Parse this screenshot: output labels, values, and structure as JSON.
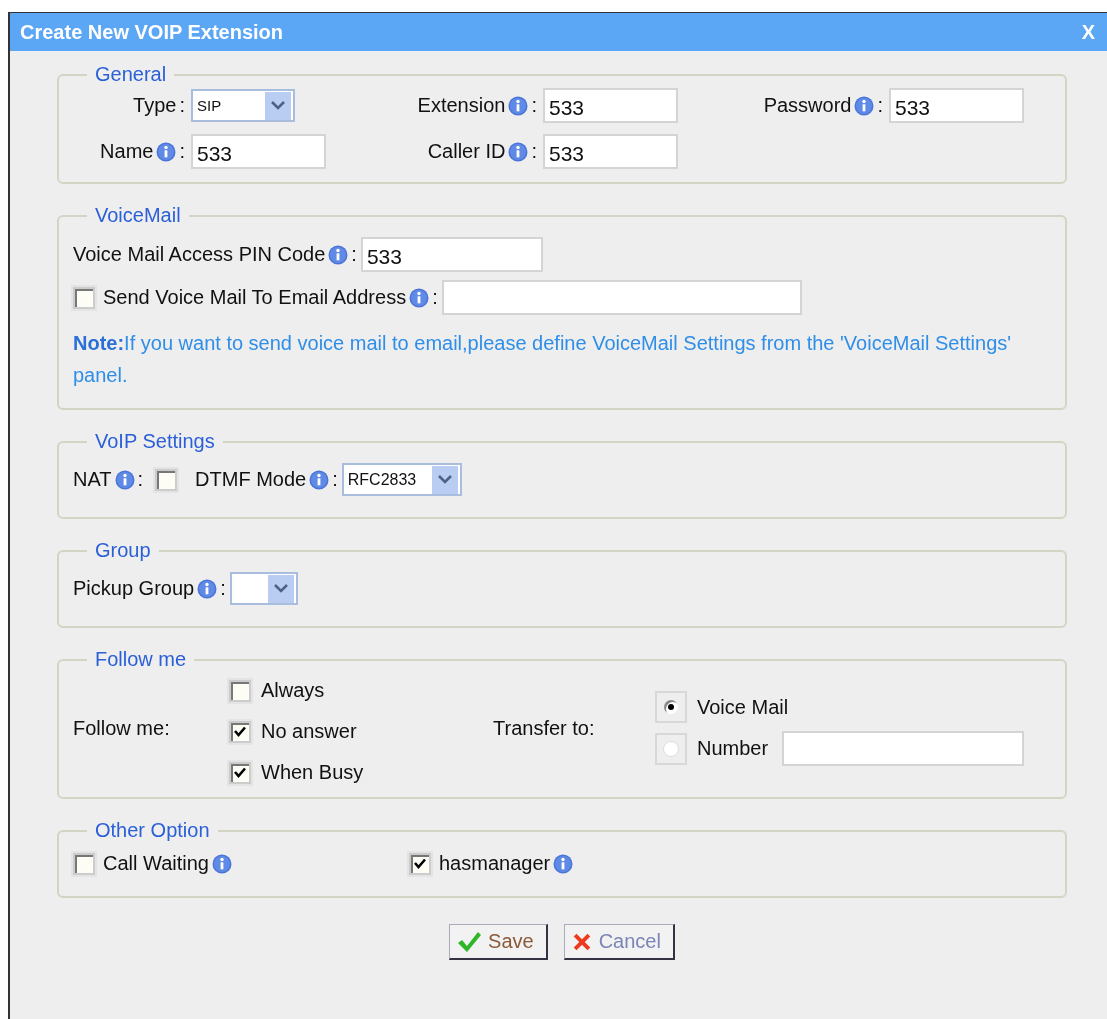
{
  "dialog": {
    "title": "Create New VOIP Extension",
    "close": "X"
  },
  "general": {
    "legend": "General",
    "fields": [
      {
        "label": "Type",
        "info": false,
        "suffix": ":",
        "kind": "select",
        "value": "SIP"
      },
      {
        "label": "Extension",
        "info": true,
        "suffix": ":",
        "kind": "input",
        "value": "533"
      },
      {
        "label": "Password",
        "info": true,
        "suffix": ":",
        "kind": "input",
        "value": "533"
      },
      {
        "label": "Name",
        "info": true,
        "suffix": ":",
        "kind": "input",
        "value": "533"
      },
      {
        "label": "Caller ID",
        "info": true,
        "suffix": ":",
        "kind": "input",
        "value": "533"
      }
    ]
  },
  "voicemail": {
    "legend": "VoiceMail",
    "pin": {
      "label": "Voice Mail Access PIN Code",
      "info": true,
      "suffix": ":",
      "value": "533"
    },
    "email": {
      "label": "Send Voice Mail To Email Address",
      "info": true,
      "suffix": ":",
      "checked": false
    },
    "note": "**Note:**If you want to send voice mail to email,please define VoiceMail Settings from the 'VoiceMail Settings' panel."
  },
  "voip": {
    "legend": "VoIP Settings",
    "nat": {
      "label": "NAT",
      "info": true,
      "suffix": ":",
      "checked": false
    },
    "dtmf": {
      "label": "DTMF Mode",
      "info": true,
      "suffix": ":",
      "value": "RFC2833"
    }
  },
  "group": {
    "legend": "Group",
    "pickup": {
      "label": "Pickup Group",
      "info": true,
      "suffix": ":"
    }
  },
  "follow": {
    "legend": "Follow me",
    "label": "Follow me:",
    "options": [
      {
        "label": "Always",
        "checked": false
      },
      {
        "label": "No answer",
        "checked": true
      },
      {
        "label": "When Busy",
        "checked": true
      }
    ],
    "transfer_label": "Transfer to:",
    "targets": [
      {
        "label": "Voice Mail",
        "selected": true,
        "kind": "plain"
      },
      {
        "label": "Number",
        "selected": false,
        "kind": "with_field"
      }
    ]
  },
  "other": {
    "legend": "Other Option",
    "options": [
      {
        "label": "Call Waiting",
        "checked": false,
        "info": true
      },
      {
        "label": "hasmanager",
        "checked": true,
        "info": true
      }
    ]
  },
  "buttons": [
    {
      "label": "Save",
      "kind": "save"
    },
    {
      "label": "Cancel",
      "kind": "cancel"
    }
  ]
}
